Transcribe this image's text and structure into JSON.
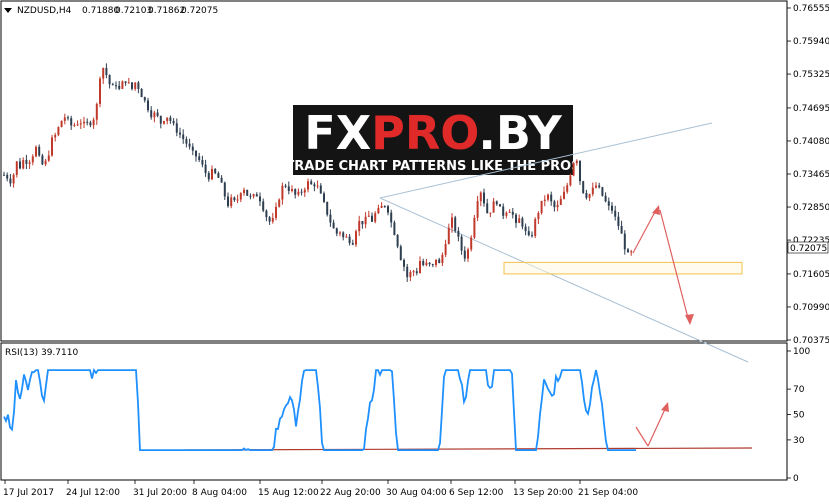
{
  "chart_data": [
    {
      "type": "candlestick",
      "title": "NZDUSD,H4",
      "ohlc_header": [
        "0.71880",
        "0.72103",
        "0.71862",
        "0.72075"
      ],
      "y_ticks": [
        "0.76555",
        "0.75940",
        "0.75325",
        "0.74695",
        "0.74080",
        "0.73465",
        "0.72850",
        "0.72235",
        "0.71605",
        "0.70990",
        "0.70375"
      ],
      "current_price": "0.72075",
      "ylim": [
        0.70375,
        0.76555
      ],
      "x_ticks": [
        "17 Jul 2017",
        "24 Jul 12:00",
        "31 Jul 20:00",
        "8 Aug 04:00",
        "15 Aug 12:00",
        "22 Aug 20:00",
        "30 Aug 04:00",
        "6 Sep 12:00",
        "13 Sep 20:00",
        "21 Sep 04:00"
      ],
      "close_path": [
        [
          0,
          0.7345
        ],
        [
          4,
          0.734
        ],
        [
          8,
          0.733
        ],
        [
          12,
          0.737
        ],
        [
          16,
          0.736
        ],
        [
          20,
          0.7375
        ],
        [
          24,
          0.7368
        ],
        [
          28,
          0.738
        ],
        [
          32,
          0.7395
        ],
        [
          36,
          0.737
        ],
        [
          40,
          0.736
        ],
        [
          44,
          0.738
        ],
        [
          48,
          0.741
        ],
        [
          52,
          0.742
        ],
        [
          56,
          0.744
        ],
        [
          60,
          0.7455
        ],
        [
          64,
          0.7445
        ],
        [
          68,
          0.7435
        ],
        [
          72,
          0.744
        ],
        [
          76,
          0.7445
        ],
        [
          80,
          0.7438
        ],
        [
          84,
          0.744
        ],
        [
          88,
          0.7445
        ],
        [
          92,
          0.746
        ],
        [
          96,
          0.753
        ],
        [
          100,
          0.7548
        ],
        [
          104,
          0.752
        ],
        [
          108,
          0.7505
        ],
        [
          112,
          0.7515
        ],
        [
          116,
          0.75
        ],
        [
          120,
          0.7525
        ],
        [
          124,
          0.7515
        ],
        [
          128,
          0.7505
        ],
        [
          132,
          0.752
        ],
        [
          136,
          0.75
        ],
        [
          140,
          0.7485
        ],
        [
          144,
          0.747
        ],
        [
          148,
          0.7455
        ],
        [
          152,
          0.746
        ],
        [
          156,
          0.744
        ],
        [
          160,
          0.745
        ],
        [
          164,
          0.7455
        ],
        [
          168,
          0.744
        ],
        [
          172,
          0.743
        ],
        [
          176,
          0.742
        ],
        [
          180,
          0.741
        ],
        [
          184,
          0.74
        ],
        [
          188,
          0.7385
        ],
        [
          192,
          0.738
        ],
        [
          196,
          0.737
        ],
        [
          200,
          0.7355
        ],
        [
          204,
          0.734
        ],
        [
          208,
          0.735
        ],
        [
          212,
          0.7345
        ],
        [
          216,
          0.7335
        ],
        [
          220,
          0.731
        ],
        [
          224,
          0.729
        ],
        [
          228,
          0.73
        ],
        [
          232,
          0.729
        ],
        [
          236,
          0.7315
        ],
        [
          240,
          0.732
        ],
        [
          244,
          0.7305
        ],
        [
          248,
          0.73
        ],
        [
          252,
          0.731
        ],
        [
          256,
          0.73
        ],
        [
          260,
          0.728
        ],
        [
          264,
          0.726
        ],
        [
          268,
          0.7255
        ],
        [
          272,
          0.728
        ],
        [
          276,
          0.731
        ],
        [
          280,
          0.733
        ],
        [
          284,
          0.732
        ],
        [
          288,
          0.7315
        ],
        [
          292,
          0.7305
        ],
        [
          296,
          0.731
        ],
        [
          300,
          0.732
        ],
        [
          304,
          0.733
        ],
        [
          308,
          0.7325
        ],
        [
          312,
          0.733
        ],
        [
          316,
          0.731
        ],
        [
          320,
          0.729
        ],
        [
          324,
          0.727
        ],
        [
          328,
          0.725
        ],
        [
          332,
          0.7235
        ],
        [
          336,
          0.724
        ],
        [
          340,
          0.7225
        ],
        [
          344,
          0.723
        ],
        [
          348,
          0.7215
        ],
        [
          352,
          0.7245
        ],
        [
          356,
          0.726
        ],
        [
          360,
          0.7255
        ],
        [
          364,
          0.727
        ],
        [
          368,
          0.726
        ],
        [
          372,
          0.7275
        ],
        [
          376,
          0.728
        ],
        [
          380,
          0.7292
        ],
        [
          384,
          0.728
        ],
        [
          388,
          0.725
        ],
        [
          392,
          0.723
        ],
        [
          396,
          0.7195
        ],
        [
          400,
          0.7175
        ],
        [
          404,
          0.715
        ],
        [
          408,
          0.717
        ],
        [
          412,
          0.716
        ],
        [
          416,
          0.7185
        ],
        [
          420,
          0.7175
        ],
        [
          424,
          0.718
        ],
        [
          428,
          0.717
        ],
        [
          432,
          0.719
        ],
        [
          436,
          0.7175
        ],
        [
          440,
          0.721
        ],
        [
          444,
          0.724
        ],
        [
          448,
          0.726
        ],
        [
          452,
          0.724
        ],
        [
          456,
          0.7215
        ],
        [
          460,
          0.719
        ],
        [
          464,
          0.7205
        ],
        [
          468,
          0.724
        ],
        [
          472,
          0.729
        ],
        [
          476,
          0.732
        ],
        [
          480,
          0.7295
        ],
        [
          484,
          0.727
        ],
        [
          488,
          0.7285
        ],
        [
          492,
          0.73
        ],
        [
          496,
          0.728
        ],
        [
          500,
          0.727
        ],
        [
          504,
          0.7285
        ],
        [
          508,
          0.7275
        ],
        [
          512,
          0.725
        ],
        [
          516,
          0.7265
        ],
        [
          520,
          0.7245
        ],
        [
          524,
          0.7225
        ],
        [
          528,
          0.7235
        ],
        [
          532,
          0.7265
        ],
        [
          536,
          0.7285
        ],
        [
          540,
          0.73
        ],
        [
          544,
          0.7305
        ],
        [
          548,
          0.729
        ],
        [
          552,
          0.728
        ],
        [
          556,
          0.7295
        ],
        [
          560,
          0.731
        ],
        [
          564,
          0.733
        ],
        [
          568,
          0.736
        ],
        [
          572,
          0.7385
        ],
        [
          576,
          0.7335
        ],
        [
          580,
          0.731
        ],
        [
          584,
          0.7305
        ],
        [
          588,
          0.7315
        ],
        [
          592,
          0.7325
        ],
        [
          596,
          0.7315
        ],
        [
          600,
          0.73
        ],
        [
          604,
          0.7285
        ],
        [
          608,
          0.728
        ],
        [
          612,
          0.726
        ],
        [
          616,
          0.7245
        ],
        [
          620,
          0.7215
        ],
        [
          624,
          0.7195
        ],
        [
          628,
          0.72
        ],
        [
          632,
          0.7207
        ]
      ],
      "support_zone": [
        0.71605,
        0.7182
      ],
      "indicator": {
        "name": "RSI(13)",
        "value": "39.7110",
        "y_ticks": [
          "100",
          "70",
          "50",
          "30",
          "0"
        ],
        "ylim": [
          0,
          100
        ]
      }
    }
  ],
  "watermark": {
    "logo_text": "FXPRO.BY",
    "tagline": "TRADE CHART PATTERNS LIKE THE PROS"
  },
  "colors": {
    "bull": "#c0392b",
    "bear": "#2c3e50",
    "rsi": "#1e90ff",
    "arrow": "#e06060",
    "trendline": "#a9c0d4",
    "support_zone": "#f3c14b",
    "rsi_line": "#b03a2e"
  }
}
